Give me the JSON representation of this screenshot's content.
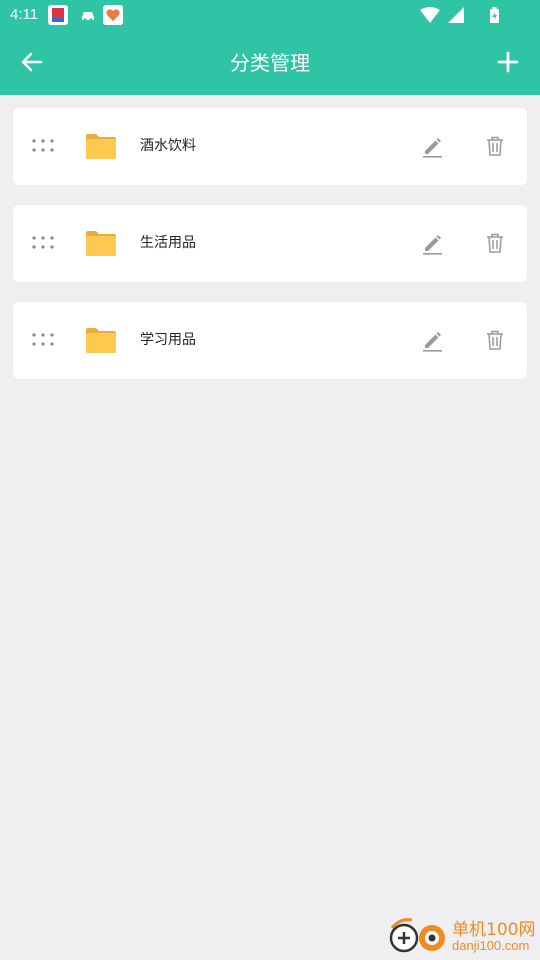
{
  "status_bar": {
    "time": "4:11"
  },
  "app_bar": {
    "title": "分类管理"
  },
  "categories": [
    {
      "name": "酒水饮料"
    },
    {
      "name": "生活用品"
    },
    {
      "name": "学习用品"
    }
  ],
  "watermark": {
    "title": "单机100网",
    "url": "danji100.com"
  },
  "colors": {
    "accent": "#2ec4a5",
    "background": "#efeff1",
    "folder": "#ffc94f",
    "icon_gray": "#999999"
  },
  "icons": {
    "back": "arrow-left-icon",
    "add": "plus-icon",
    "drag": "drag-handle-icon",
    "folder": "folder-icon",
    "edit": "pencil-icon",
    "delete": "trash-icon"
  }
}
